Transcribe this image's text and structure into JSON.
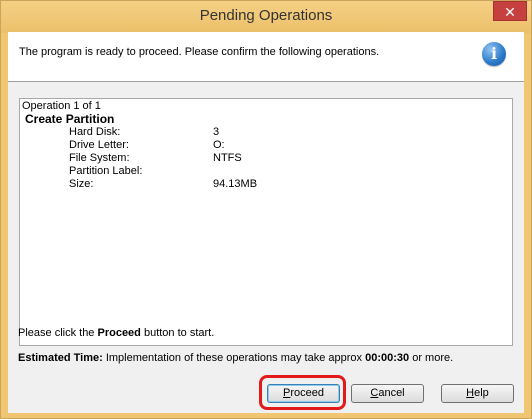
{
  "window": {
    "title": "Pending Operations",
    "close_glyph": "✕"
  },
  "header": {
    "message": "The program is ready to proceed. Please confirm the following operations.",
    "icon": "info-icon",
    "icon_glyph": "i"
  },
  "operations": {
    "count_text": "Operation 1 of 1",
    "action": "Create Partition",
    "rows": [
      {
        "label": "Hard Disk:",
        "value": "3"
      },
      {
        "label": "Drive Letter:",
        "value": "O:"
      },
      {
        "label": "File System:",
        "value": "NTFS"
      },
      {
        "label": "Partition Label:",
        "value": ""
      },
      {
        "label": "Size:",
        "value": "94.13MB"
      }
    ]
  },
  "instruction": {
    "before": "Please click the ",
    "bold": "Proceed",
    "after": " button to start."
  },
  "estimate": {
    "label": "Estimated Time:",
    "text": " Implementation of these operations may take approx ",
    "time": "00:00:30",
    "after": " or more."
  },
  "buttons": {
    "proceed": {
      "mnemonic": "P",
      "rest": "roceed"
    },
    "cancel": {
      "mnemonic": "C",
      "rest": "ancel"
    },
    "help": {
      "mnemonic": "H",
      "rest": "elp"
    }
  },
  "colors": {
    "titlebar": "#f0c672",
    "close": "#c74040",
    "highlight": "#e11a1a",
    "info": "#2a78c8"
  }
}
